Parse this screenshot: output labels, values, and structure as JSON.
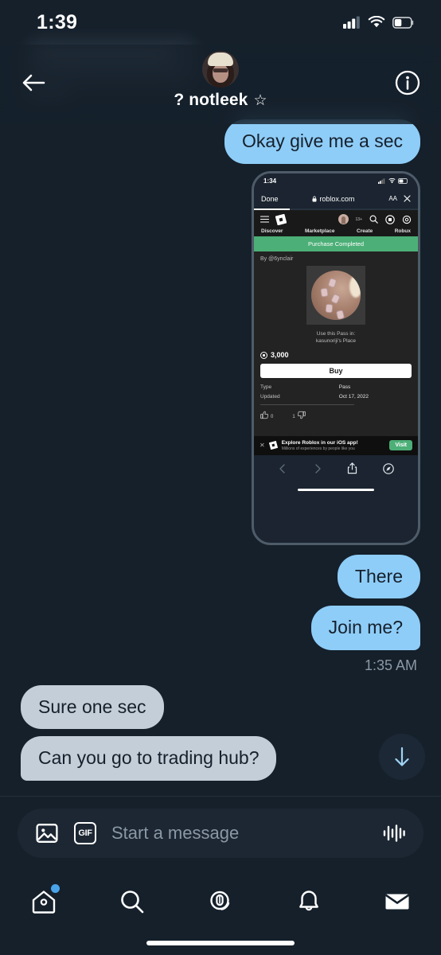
{
  "status_bar": {
    "time": "1:39",
    "icons": [
      "cellular-signal-icon",
      "wifi-icon",
      "battery-icon"
    ]
  },
  "header": {
    "back_icon": "back-arrow-icon",
    "info_icon": "info-circle-icon",
    "avatar_alt": "notleek-avatar",
    "name": "? notleek",
    "verified_star": "☆"
  },
  "conversation": {
    "messages": [
      {
        "id": "m1",
        "side": "out",
        "text": "Okay give me a sec"
      },
      {
        "id": "m2",
        "side": "out",
        "type": "image-attachment"
      },
      {
        "id": "m3",
        "side": "out",
        "text": "There"
      },
      {
        "id": "m4",
        "side": "out",
        "text": "Join me?"
      },
      {
        "id": "m5",
        "side": "in",
        "text": "Sure one sec"
      },
      {
        "id": "m6",
        "side": "in",
        "text": "Can you go to trading hub?"
      }
    ],
    "timestamp": "1:35 AM",
    "scroll_to_bottom_icon": "arrow-down-icon"
  },
  "embedded_screenshot": {
    "phone_status": {
      "time": "1:34"
    },
    "safari": {
      "done_label": "Done",
      "lock_icon": "lock-icon",
      "url": "roblox.com",
      "text_size_label": "AA",
      "close_icon": "close-icon"
    },
    "roblox_nav": {
      "menu_icon": "hamburger-menu-icon",
      "logo_icon": "roblox-logo-icon",
      "age_badge": "13+",
      "search_icon": "search-icon",
      "robux_icon": "robux-coin-icon",
      "settings_icon": "gear-icon",
      "tabs": [
        "Discover",
        "Marketplace",
        "Create",
        "Robux"
      ]
    },
    "banner": {
      "text": "Purchase Completed",
      "color": "#4caf77"
    },
    "item": {
      "creator": "By @6ynclair",
      "use_in_label": "Use this Pass in:",
      "place_name": "kasunoriji's Place",
      "price": "3,000",
      "price_icon": "robux-coin-icon",
      "buy_label": "Buy",
      "meta": [
        {
          "key": "Type",
          "value": "Pass"
        },
        {
          "key": "Updated",
          "value": "Oct 17, 2022"
        }
      ],
      "likes": "0",
      "dislikes": "1",
      "like_icon": "thumbs-up-icon",
      "dislike_icon": "thumbs-down-icon"
    },
    "app_banner": {
      "close_icon": "close-icon",
      "logo_icon": "roblox-logo-icon",
      "title": "Explore Roblox in our iOS app!",
      "subtitle": "Millions of experiences by people like you",
      "cta_label": "Visit",
      "cta_color": "#4caf77"
    },
    "toolbar": {
      "back_icon": "chevron-left-icon",
      "forward_icon": "chevron-right-icon",
      "share_icon": "share-icon",
      "safari-compass_icon": "compass-icon"
    }
  },
  "composer": {
    "image_icon": "image-icon",
    "gif_icon": "gif-icon",
    "gif_label": "GIF",
    "placeholder": "Start a message",
    "value": "",
    "voice_icon": "voice-waveform-icon"
  },
  "bottom_nav": {
    "items": [
      {
        "name": "home",
        "icon": "home-icon",
        "badge": true
      },
      {
        "name": "search",
        "icon": "search-icon",
        "badge": false
      },
      {
        "name": "spaces",
        "icon": "spaces-microphone-icon",
        "badge": false
      },
      {
        "name": "notifications",
        "icon": "bell-icon",
        "badge": false
      },
      {
        "name": "messages",
        "icon": "envelope-icon",
        "badge": false
      }
    ]
  },
  "colors": {
    "background": "#15202b",
    "outgoing_bubble": "#8ecdf8",
    "incoming_bubble": "#c3ced8",
    "accent": "#4aa3e8",
    "bubble_text": "#16202c",
    "muted_text": "#8b98a5"
  }
}
